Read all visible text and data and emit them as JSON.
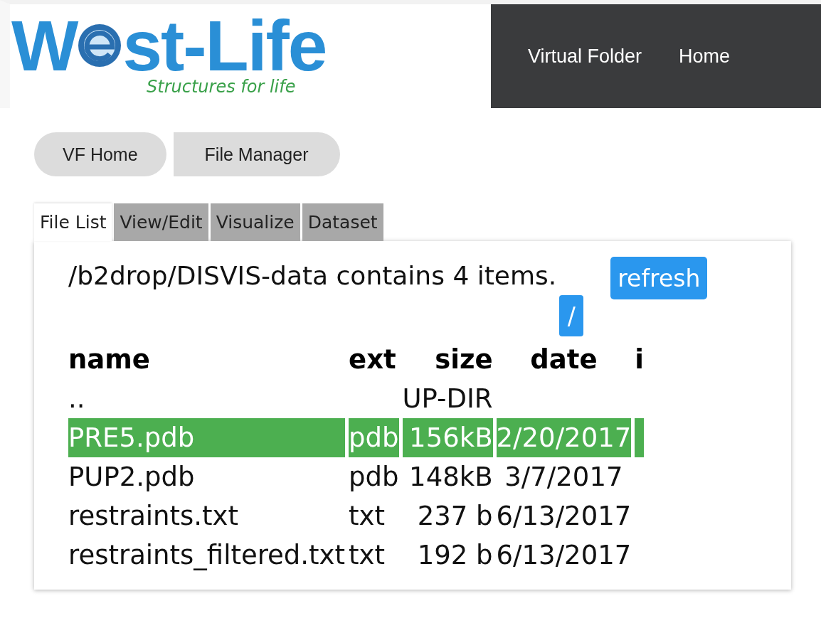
{
  "logo": {
    "part_1": "W",
    "part_2": "st-Life",
    "tagline": "Structures for life"
  },
  "nav": [
    "Virtual Folder",
    "Home"
  ],
  "breadcrumbs": [
    "VF Home",
    "File Manager"
  ],
  "tabs": [
    {
      "label": "File List",
      "selected": true
    },
    {
      "label": "View/Edit",
      "selected": false
    },
    {
      "label": "Visualize",
      "selected": false
    },
    {
      "label": "Dataset",
      "selected": false
    }
  ],
  "summary": "/b2drop/DISVIS-data contains 4 items.",
  "refresh_button": "refresh",
  "root_button": "/",
  "table": {
    "columns": [
      "name",
      "ext",
      "size",
      "date",
      "i"
    ],
    "rows": [
      {
        "cells": [
          "..",
          "",
          "UP-DIR",
          "",
          ""
        ],
        "selected": false
      },
      {
        "cells": [
          "PRE5.pdb",
          "pdb",
          "156kB",
          "2/20/2017",
          ""
        ],
        "selected": true
      },
      {
        "cells": [
          "PUP2.pdb",
          "pdb",
          "148kB",
          "3/7/2017",
          ""
        ],
        "selected": false
      },
      {
        "cells": [
          "restraints.txt",
          "txt",
          "237 b",
          "6/13/2017",
          ""
        ],
        "selected": false
      },
      {
        "cells": [
          "restraints_filtered.txt",
          "txt",
          "192 b",
          "6/13/2017",
          ""
        ],
        "selected": false
      }
    ]
  }
}
